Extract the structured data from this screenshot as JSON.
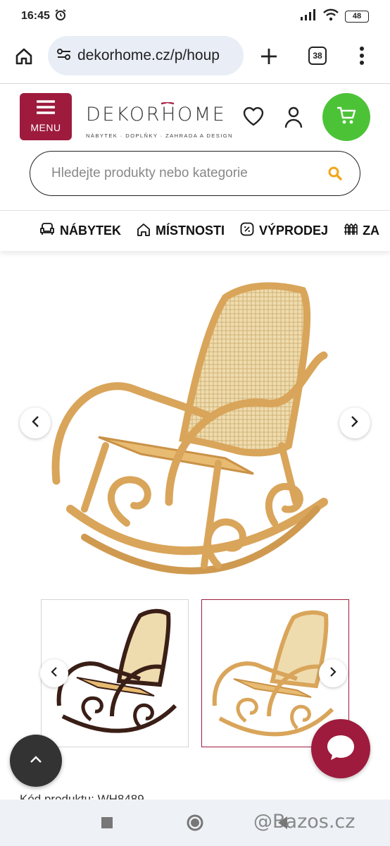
{
  "status_bar": {
    "time": "16:45",
    "battery": "48"
  },
  "browser": {
    "url": "dekorhome.cz/p/houp",
    "tab_count": "38"
  },
  "header": {
    "menu_label": "MENU",
    "logo_main": "DEKORHOME",
    "logo_tagline": "NÁBYTEK · DOPLŇKY · ZAHRADA A DESIGN"
  },
  "search": {
    "placeholder": "Hledejte produkty nebo kategorie"
  },
  "categories": [
    {
      "label": "NÁBYTEK",
      "icon": "armchair-icon"
    },
    {
      "label": "MÍSTNOSTI",
      "icon": "home-icon"
    },
    {
      "label": "VÝPRODEJ",
      "icon": "percent-icon"
    },
    {
      "label": "ZA",
      "icon": "garden-fence-icon"
    }
  ],
  "product": {
    "code_text": "Kód produktu: WH8489",
    "thumbnails": [
      {
        "variant": "dark-brown"
      },
      {
        "variant": "natural",
        "selected": true
      }
    ]
  },
  "colors": {
    "brand": "#9e1b3d",
    "cart": "#4cc337",
    "wood": "#d9a55a",
    "wood_dark": "#3a1f17",
    "cane": "#efdcae"
  },
  "watermark": "@Bazos.cz"
}
